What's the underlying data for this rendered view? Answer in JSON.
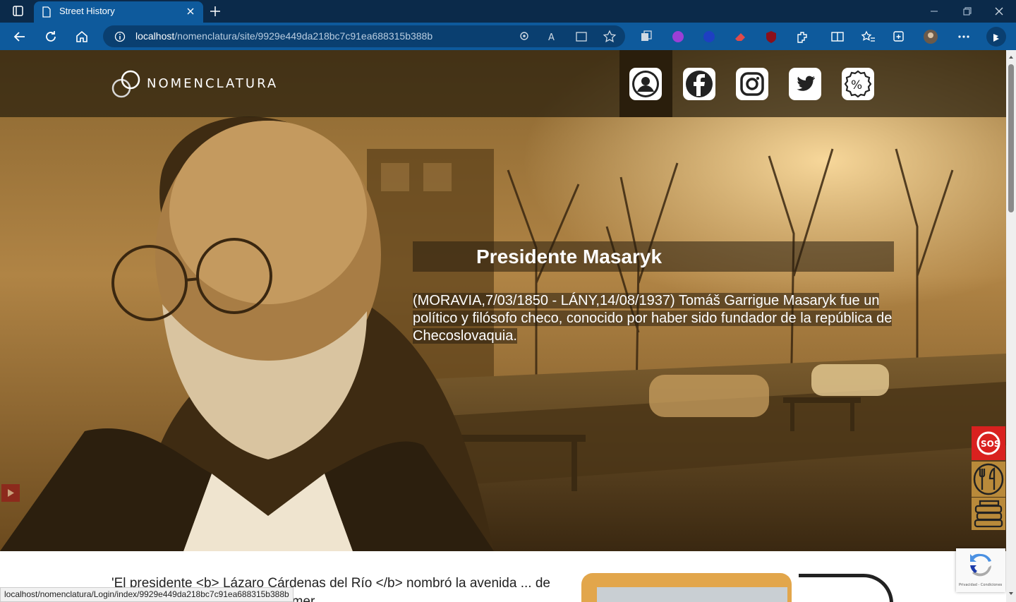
{
  "browser": {
    "tab_title": "Street History",
    "url_host": "localhost",
    "url_path": "/nomenclatura/site/9929e449da218bc7c91ea688315b388b"
  },
  "site": {
    "logo_text": "NOMENCLATURA",
    "social": [
      "user-icon",
      "facebook-icon",
      "instagram-icon",
      "twitter-icon",
      "discount-icon"
    ]
  },
  "hero": {
    "title": "Presidente Masaryk",
    "description": "(MORAVIA,7/03/1850 - LÁNY,14/08/1937) Tomáš Garrigue Masaryk fue un político y filósofo checo, conocido por haber sido fundador de la república de Checoslovaquia."
  },
  "content": {
    "paragraph": "'El presidente <b> Lázaro Cárdenas del Río </b> nombró la avenida ... de <b>Tomáš Masaryk</b>, el primer"
  },
  "side_buttons": [
    "sos-icon",
    "food-icon",
    "books-icon"
  ],
  "recaptcha": {
    "terms": "Privacidad - Condiciones"
  },
  "status_bar": {
    "url": "localhost/nomenclatura/Login/index/9929e449da218bc7c91ea688315b388b"
  },
  "colors": {
    "tab_bar": "#0b2a4a",
    "nav_bar": "#0e5a9c",
    "sepia": "#b98a3a",
    "sos_red": "#d9211f"
  }
}
